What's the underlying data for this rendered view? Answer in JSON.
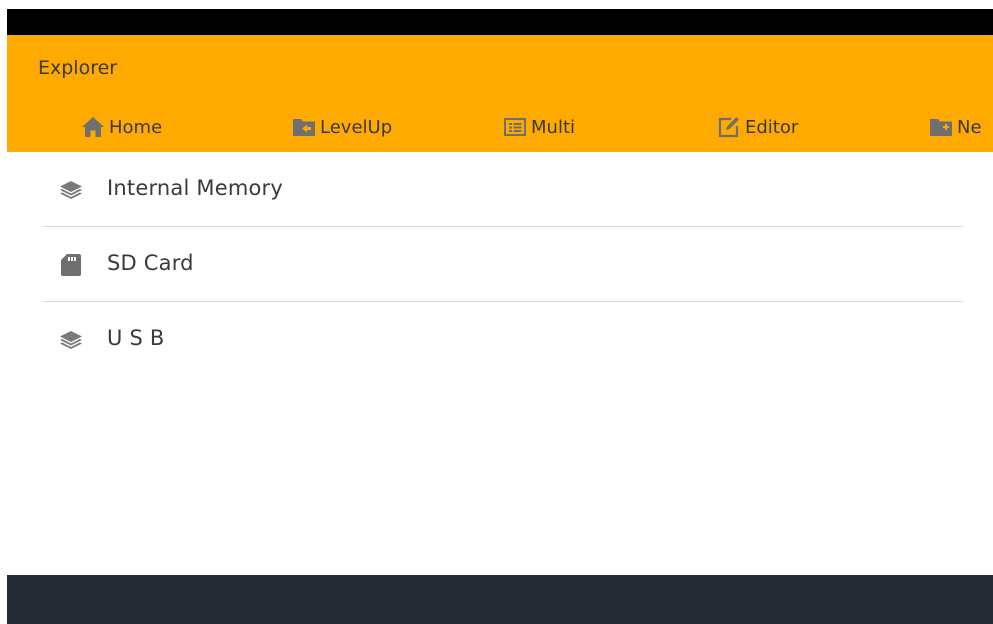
{
  "app": {
    "title": "Explorer"
  },
  "colors": {
    "header": "#ffaa00",
    "status_bar": "#000000",
    "bottom_bar": "#252a35",
    "text": "#3a3a3a",
    "icon": "#6f6f6f"
  },
  "toolbar": {
    "home_label": "Home",
    "home_icon": "home-icon",
    "levelup_label": "LevelUp",
    "levelup_icon": "folder-back-icon",
    "multi_label": "Multi",
    "multi_icon": "multi-select-icon",
    "editor_label": "Editor",
    "editor_icon": "edit-icon",
    "new_label": "Ne",
    "new_icon": "folder-add-icon"
  },
  "storage": {
    "items": [
      {
        "label": "Internal Memory",
        "icon": "layers-icon"
      },
      {
        "label": "SD Card",
        "icon": "sd-card-icon"
      },
      {
        "label": "U S B",
        "icon": "layers-icon"
      }
    ]
  }
}
